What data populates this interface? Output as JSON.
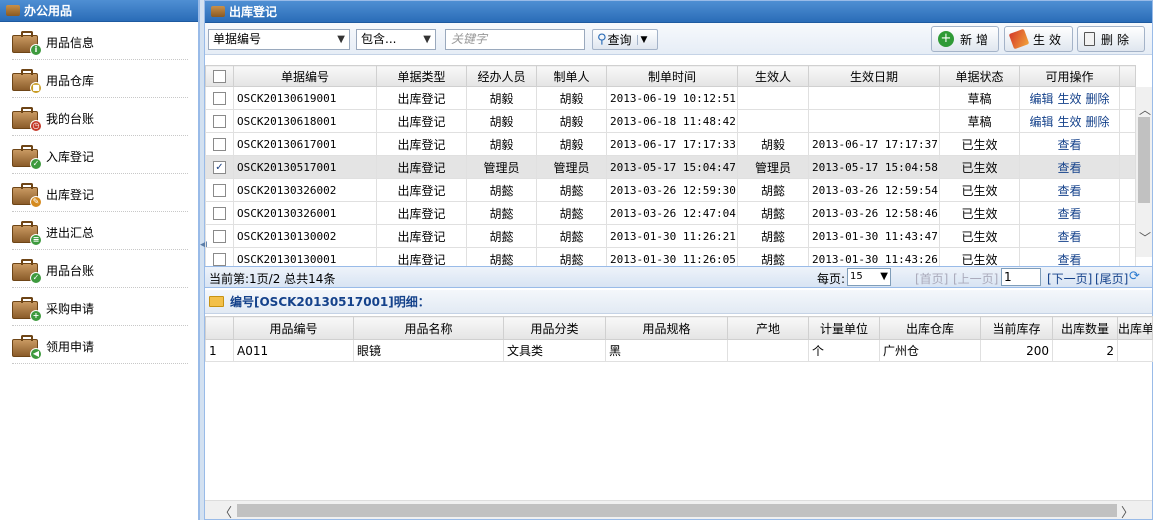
{
  "sidebar": {
    "title": "办公用品",
    "items": [
      {
        "label": "用品信息",
        "icon": "info-badge-icon",
        "badge_color": "#3e9a3e",
        "badge": "i"
      },
      {
        "label": "用品仓库",
        "icon": "lock-badge-icon",
        "badge_color": "#c89b22",
        "badge": "■"
      },
      {
        "label": "我的台账",
        "icon": "clock-badge-icon",
        "badge_color": "#c43b2b",
        "badge": "◷"
      },
      {
        "label": "入库登记",
        "icon": "check-badge-icon",
        "badge_color": "#3e9a3e",
        "badge": "✓"
      },
      {
        "label": "出库登记",
        "icon": "pencil-badge-icon",
        "badge_color": "#d58a1e",
        "badge": "✎"
      },
      {
        "label": "进出汇总",
        "icon": "list-badge-icon",
        "badge_color": "#3e9a3e",
        "badge": "≡"
      },
      {
        "label": "用品台账",
        "icon": "check-badge-icon",
        "badge_color": "#3e9a3e",
        "badge": "✓"
      },
      {
        "label": "采购申请",
        "icon": "plus-badge-icon",
        "badge_color": "#3e9a3e",
        "badge": "+"
      },
      {
        "label": "领用申请",
        "icon": "arrow-badge-icon",
        "badge_color": "#3e9a3e",
        "badge": "◀"
      }
    ]
  },
  "main": {
    "title": "出库登记",
    "toolbar": {
      "field_select": "单据编号",
      "op_select": "包含...",
      "keyword_placeholder": "关键字",
      "search_label": "查询",
      "add_label": "新增",
      "activate_label": "生效",
      "delete_label": "删除"
    },
    "grid": {
      "headers": [
        "单据编号",
        "单据类型",
        "经办人员",
        "制单人",
        "制单时间",
        "生效人",
        "生效日期",
        "单据状态",
        "可用操作"
      ],
      "rows": [
        {
          "checked": false,
          "id": "OSCK20130619001",
          "type": "出库登记",
          "handler": "胡毅",
          "maker": "胡毅",
          "made": "2013-06-19 10:12:51",
          "effector": "",
          "effective": "",
          "status": "草稿",
          "ops": [
            "编辑",
            "生效",
            "删除"
          ]
        },
        {
          "checked": false,
          "id": "OSCK20130618001",
          "type": "出库登记",
          "handler": "胡毅",
          "maker": "胡毅",
          "made": "2013-06-18 11:48:42",
          "effector": "",
          "effective": "",
          "status": "草稿",
          "ops": [
            "编辑",
            "生效",
            "删除"
          ]
        },
        {
          "checked": false,
          "id": "OSCK20130617001",
          "type": "出库登记",
          "handler": "胡毅",
          "maker": "胡毅",
          "made": "2013-06-17 17:17:33",
          "effector": "胡毅",
          "effective": "2013-06-17 17:17:37",
          "status": "已生效",
          "ops": [
            "查看"
          ]
        },
        {
          "checked": true,
          "id": "OSCK20130517001",
          "type": "出库登记",
          "handler": "管理员",
          "maker": "管理员",
          "made": "2013-05-17 15:04:47",
          "effector": "管理员",
          "effective": "2013-05-17 15:04:58",
          "status": "已生效",
          "ops": [
            "查看"
          ]
        },
        {
          "checked": false,
          "id": "OSCK20130326002",
          "type": "出库登记",
          "handler": "胡懿",
          "maker": "胡懿",
          "made": "2013-03-26 12:59:30",
          "effector": "胡懿",
          "effective": "2013-03-26 12:59:54",
          "status": "已生效",
          "ops": [
            "查看"
          ]
        },
        {
          "checked": false,
          "id": "OSCK20130326001",
          "type": "出库登记",
          "handler": "胡懿",
          "maker": "胡懿",
          "made": "2013-03-26 12:47:04",
          "effector": "胡懿",
          "effective": "2013-03-26 12:58:46",
          "status": "已生效",
          "ops": [
            "查看"
          ]
        },
        {
          "checked": false,
          "id": "OSCK20130130002",
          "type": "出库登记",
          "handler": "胡懿",
          "maker": "胡懿",
          "made": "2013-01-30 11:26:21",
          "effector": "胡懿",
          "effective": "2013-01-30 11:43:47",
          "status": "已生效",
          "ops": [
            "查看"
          ]
        },
        {
          "checked": false,
          "id": "OSCK20130130001",
          "type": "出库登记",
          "handler": "胡懿",
          "maker": "胡懿",
          "made": "2013-01-30 11:26:05",
          "effector": "胡懿",
          "effective": "2013-01-30 11:43:26",
          "status": "已生效",
          "ops": [
            "查看"
          ]
        }
      ]
    },
    "pager": {
      "summary": "当前第:1页/2 总共14条",
      "per_page_label": "每页:",
      "per_page": "15",
      "first": "[首页]",
      "prev": "[上一页]",
      "page_input": "1",
      "next": "[下一页]",
      "last": "[尾页]"
    },
    "detail": {
      "title": "编号[OSCK20130517001]明细：",
      "headers": [
        "用品编号",
        "用品名称",
        "用品分类",
        "用品规格",
        "产地",
        "计量单位",
        "出库仓库",
        "当前库存",
        "出库数量",
        "出库单"
      ],
      "rows": [
        {
          "no": "1",
          "code": "A011",
          "name": "眼镜",
          "category": "文具类",
          "spec": "黑",
          "origin": "",
          "unit": "个",
          "warehouse": "广州仓",
          "stock": "200",
          "qty": "2",
          "extra": ""
        }
      ]
    }
  },
  "colors": {
    "header_blue": "#2a6cb7",
    "link_blue": "#15428b",
    "border_blue": "#99bbe8"
  }
}
